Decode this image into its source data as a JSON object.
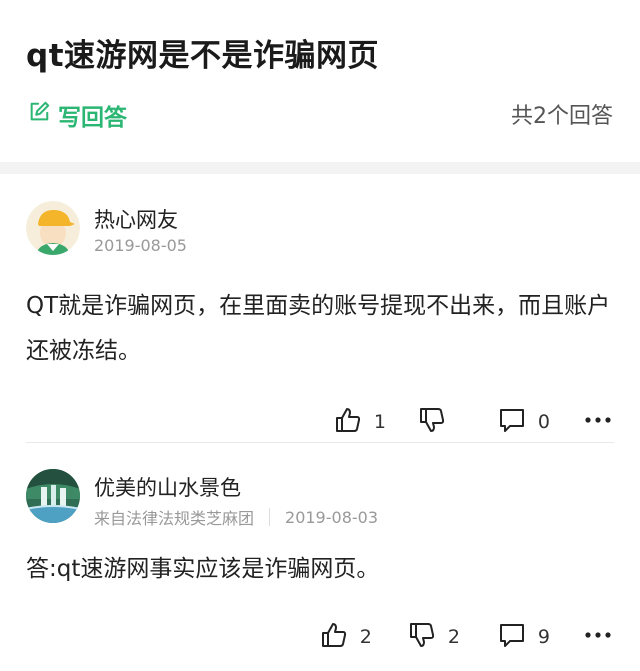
{
  "question": {
    "title": "qt速游网是不是诈骗网页",
    "write_answer_label": "写回答",
    "answer_count": "共2个回答"
  },
  "answers": [
    {
      "username": "热心网友",
      "date": "2019-08-05",
      "content": "QT就是诈骗网页，在里面卖的账号提现不出来，而且账户还被冻结。",
      "likes": "1",
      "comments": "0"
    },
    {
      "username": "优美的山水景色",
      "source": "来自法律法规类芝麻团",
      "date": "2019-08-03",
      "content": "答:qt速游网事实应该是诈骗网页。",
      "likes": "2",
      "dislikes": "2",
      "comments": "9"
    }
  ],
  "colors": {
    "accent": "#2bb673",
    "section_gap": "#f3f3f3"
  }
}
